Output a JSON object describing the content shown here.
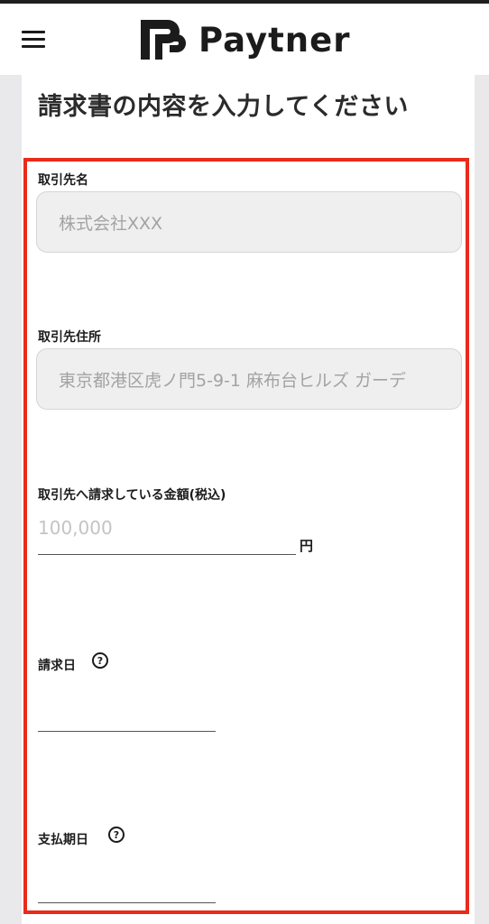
{
  "header": {
    "brand_name": "Paytner",
    "menu_icon": "hamburger-menu-icon",
    "logo_icon": "paytner-logo-icon"
  },
  "page": {
    "title": "請求書の内容を入力してください"
  },
  "form": {
    "client_name": {
      "label": "取引先名",
      "placeholder": "株式会社XXX"
    },
    "client_address": {
      "label": "取引先住所",
      "placeholder": "東京都港区虎ノ門5-9-1 麻布台ヒルズ ガーデ"
    },
    "amount": {
      "label": "取引先へ請求している金額(税込)",
      "placeholder": "100,000",
      "unit": "円"
    },
    "invoice_date": {
      "label": "請求日",
      "help_icon": "question-circle-icon",
      "help_glyph": "?"
    },
    "due_date": {
      "label": "支払期日",
      "help_icon": "question-circle-icon",
      "help_glyph": "?"
    }
  },
  "colors": {
    "highlight_border": "#ea2a1a",
    "field_background": "#efefef",
    "outer_background": "#e9e9ec"
  }
}
